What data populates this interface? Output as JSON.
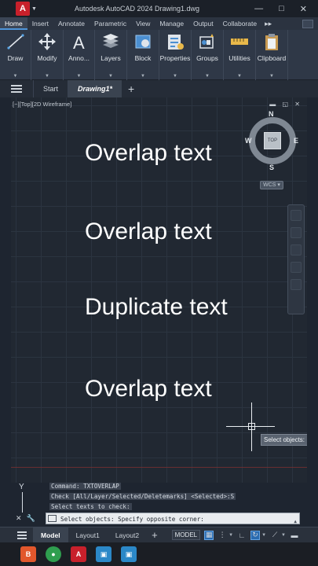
{
  "window": {
    "logo_letter": "A",
    "title": "Autodesk AutoCAD 2024   Drawing1.dwg",
    "minimize": "—",
    "maximize": "□",
    "close": "✕"
  },
  "ribbon_tabs": [
    "Home",
    "Insert",
    "Annotate",
    "Parametric",
    "View",
    "Manage",
    "Output",
    "Collaborate"
  ],
  "ribbon_tab_more": "▸▸",
  "ribbon_groups": [
    {
      "label": "Draw",
      "icon": "line-icon"
    },
    {
      "label": "Modify",
      "icon": "move-icon"
    },
    {
      "label": "Anno...",
      "icon": "text-icon"
    },
    {
      "label": "Layers",
      "icon": "layers-icon"
    },
    {
      "label": "Block",
      "icon": "block-icon"
    },
    {
      "label": "Properties",
      "icon": "properties-icon"
    },
    {
      "label": "Groups",
      "icon": "groups-icon"
    },
    {
      "label": "Utilities",
      "icon": "measure-icon"
    },
    {
      "label": "Clipboard",
      "icon": "clipboard-icon"
    }
  ],
  "file_tabs": {
    "start": "Start",
    "active": "Drawing1*",
    "plus": "+"
  },
  "viewport": {
    "label": "[−][Top][2D Wireframe]",
    "controls": "▬ ◱ ✕",
    "texts": [
      "Overlap text",
      "Overlap text",
      "Duplicate text",
      "Overlap text"
    ]
  },
  "viewcube": {
    "top": "TOP",
    "north": "N",
    "south": "S",
    "east": "E",
    "west": "W",
    "wcs": "WCS ▾"
  },
  "cursor_tooltip": "Select objects:",
  "ucs": {
    "y_label": "Y"
  },
  "command_history": [
    "Command: TXTOVERLAP",
    "Check [All/Layer/Selected/Deletemarks] <Selected>:S",
    "Select texts to check:"
  ],
  "command_line": {
    "tools": [
      "✕",
      "🔧"
    ],
    "text": "Select objects: Specify opposite corner:",
    "scroll": "▲"
  },
  "status_bar": {
    "tabs": [
      "Model",
      "Layout1",
      "Layout2"
    ],
    "plus": "+",
    "model_button": "MODEL",
    "icons": [
      "grid-icon",
      "snap-icon",
      "ortho-icon",
      "polar-icon",
      "osnap-icon",
      "lineweight-icon"
    ]
  },
  "taskbar": [
    {
      "name": "brave-browser-icon",
      "glyph": "B",
      "color": "#e2572c"
    },
    {
      "name": "chrome-icon",
      "glyph": "●",
      "color": "#2f9e4f"
    },
    {
      "name": "autocad-taskbar-icon",
      "glyph": "A",
      "color": "#c8202b"
    },
    {
      "name": "photos-icon",
      "glyph": "▣",
      "color": "#2b88c8"
    },
    {
      "name": "photos-icon-2",
      "glyph": "▣",
      "color": "#2b88c8"
    }
  ]
}
